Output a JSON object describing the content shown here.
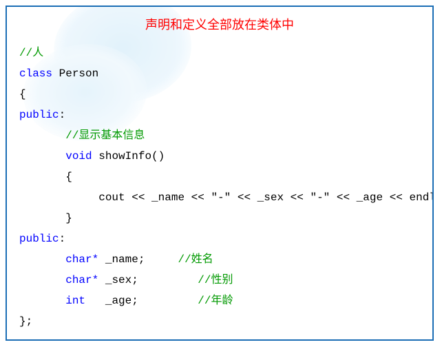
{
  "title": "声明和定义全部放在类体中",
  "code": {
    "c_person": "//人",
    "kw_class": "class",
    "name_class": "Person",
    "brace_open": "{",
    "public1": "public",
    "colon1": ":",
    "c_showinfo": "//显示基本信息",
    "kw_void": "void",
    "fn_name": "showInfo",
    "fn_parens": "()",
    "fn_brace_open": "{",
    "cout_line": "cout << _name << \"-\" << _sex << \"-\" << _age << endl;",
    "fn_brace_close": "}",
    "public2": "public",
    "colon2": ":",
    "ty_charp1": "char*",
    "m_name": "_name;",
    "c_name": "//姓名",
    "ty_charp2": "char*",
    "m_sex": "_sex;",
    "c_sex": "//性别",
    "ty_int": "int",
    "m_age": "_age;",
    "c_age": "//年龄",
    "brace_close": "};"
  }
}
